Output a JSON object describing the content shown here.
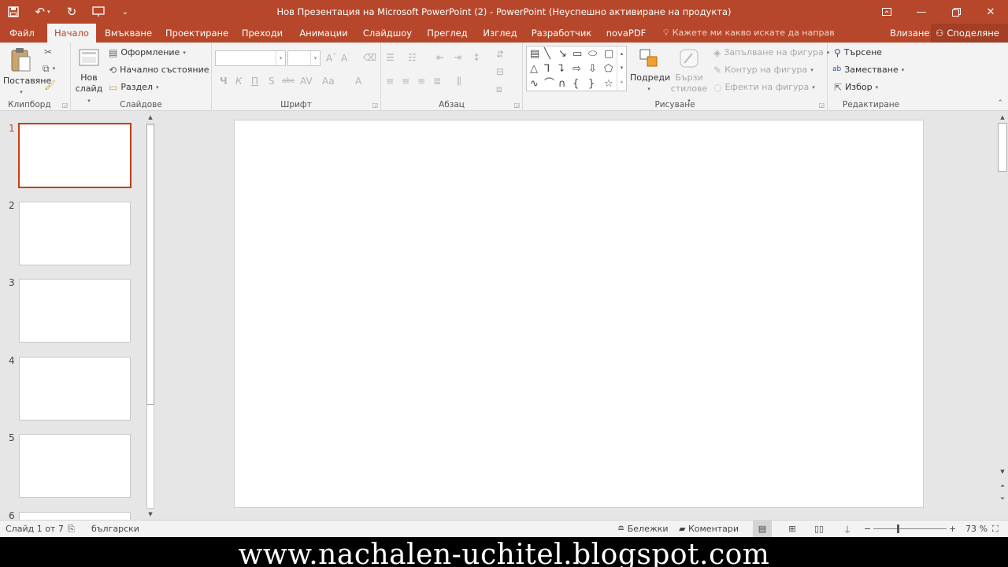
{
  "titlebar": {
    "title": "Нов Презентация на Microsoft PowerPoint (2) - PowerPoint (Неуспешно активиране на продукта)",
    "qat": [
      "save-icon",
      "undo-icon",
      "redo-icon",
      "present-icon",
      "customize-icon"
    ],
    "colors": {
      "accent": "#b7472a"
    }
  },
  "tabs": {
    "file": "Файл",
    "home": "Начало",
    "insert": "Вмъкване",
    "design": "Проектиране",
    "transitions": "Преходи",
    "animations": "Анимации",
    "slideshow": "Слайдшоу",
    "review": "Преглед",
    "view": "Изглед",
    "developer": "Разработчик",
    "novapdf": "novaPDF",
    "tellme": "Кажете ми какво искате да направ",
    "signin": "Влизане",
    "share": "Споделяне"
  },
  "ribbon": {
    "clipboard": {
      "label": "Клипборд",
      "paste": "Поставяне"
    },
    "slides": {
      "label": "Слайдове",
      "new_slide_1": "Нов",
      "new_slide_2": "слайд",
      "layout": "Оформление",
      "reset": "Начално състояние",
      "section": "Раздел"
    },
    "font": {
      "label": "Шрифт",
      "bold": "Ч",
      "italic": "К",
      "underline": "П",
      "shadow": "S",
      "strike": "abc"
    },
    "paragraph": {
      "label": "Абзац"
    },
    "drawing": {
      "label": "Рисуване",
      "arrange": "Подреди",
      "quick_styles_1": "Бързи",
      "quick_styles_2": "стилове",
      "fill": "Запълване на фигура",
      "outline": "Контур на фигура",
      "effects": "Ефекти на фигура"
    },
    "editing": {
      "label": "Редактиране",
      "find": "Търсене",
      "replace": "Заместване",
      "select": "Избор"
    }
  },
  "thumbnails": [
    {
      "number": "1",
      "selected": true
    },
    {
      "number": "2",
      "selected": false
    },
    {
      "number": "3",
      "selected": false
    },
    {
      "number": "4",
      "selected": false
    },
    {
      "number": "5",
      "selected": false
    },
    {
      "number": "6",
      "selected": false
    }
  ],
  "statusbar": {
    "slide_info": "Слайд 1 от 7",
    "language": "български",
    "notes": "Бележки",
    "comments": "Коментари",
    "zoom": "73 %"
  },
  "banner": {
    "text": "www.nachalen-uchitel.blogspot.com"
  }
}
